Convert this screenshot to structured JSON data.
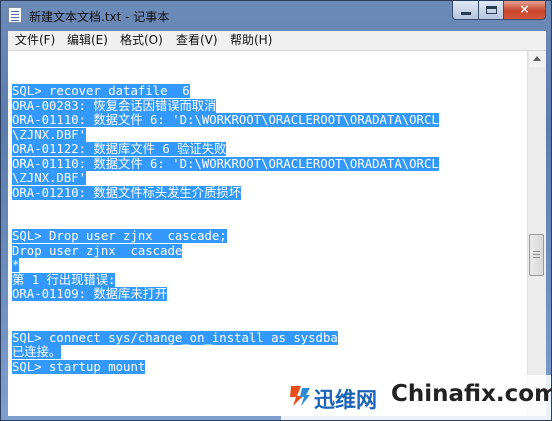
{
  "window": {
    "title": "新建文本文档.txt - 记事本",
    "app_icon": "notepad-icon",
    "controls": {
      "minimize_icon": "minimize-icon",
      "maximize_icon": "maximize-icon",
      "close_icon": "close-icon",
      "close_glyph": "×"
    }
  },
  "menu": {
    "items": [
      {
        "label": "文件(F)"
      },
      {
        "label": "编辑(E)"
      },
      {
        "label": "格式(O)"
      },
      {
        "label": "查看(V)"
      },
      {
        "label": "帮助(H)"
      }
    ]
  },
  "editor": {
    "lines": [
      "SQL> recover datafile  6",
      "ORA-00283: 恢复会话因错误而取消",
      "ORA-01110: 数据文件 6: 'D:\\WORKROOT\\ORACLEROOT\\ORADATA\\ORCL",
      "\\ZJNX.DBF'",
      "ORA-01122: 数据库文件 6 验证失败",
      "ORA-01110: 数据文件 6: 'D:\\WORKROOT\\ORACLEROOT\\ORADATA\\ORCL",
      "\\ZJNX.DBF'",
      "ORA-01210: 数据文件标头发生介质损坏",
      "",
      "",
      "SQL> Drop user zjnx  cascade;",
      "Drop user zjnx  cascade",
      "*",
      "第 1 行出现错误:",
      "ORA-01109: 数据库未打开",
      "",
      "",
      "SQL> connect sys/change_on_install as sysdba",
      "已连接。",
      "SQL> startup mount"
    ],
    "selection_color": "#3399ff"
  },
  "watermark": {
    "logo_icon": "xunwei-logo-icon",
    "brand_cn": "迅维网",
    "brand_en": "Chinafix.com"
  }
}
